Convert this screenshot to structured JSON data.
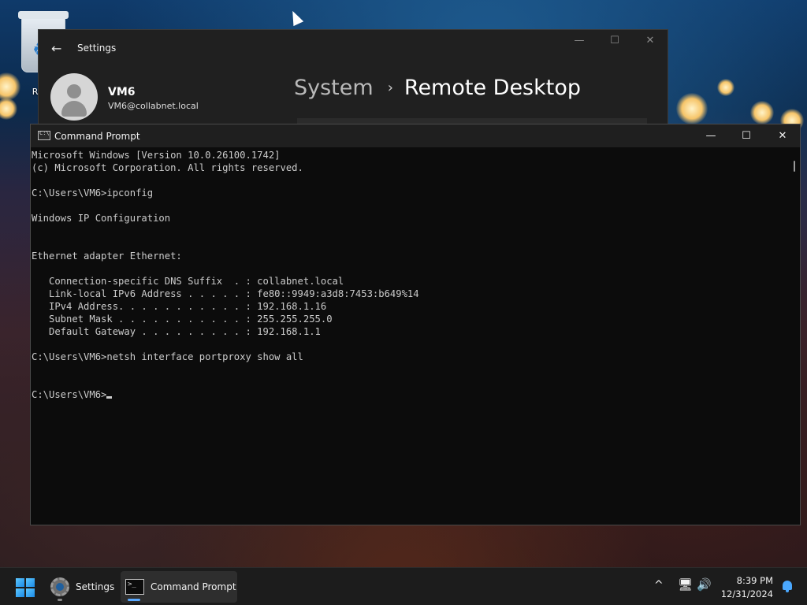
{
  "desktop": {
    "recycle_bin_label": "Recy"
  },
  "settings_window": {
    "title": "Settings",
    "back_icon": "back-arrow-icon",
    "user": {
      "name": "VM6",
      "email": "VM6@collabnet.local"
    },
    "breadcrumb": {
      "parent": "System",
      "separator": "›",
      "current": "Remote Desktop"
    },
    "controls": {
      "minimize": "—",
      "maximize": "☐",
      "close": "✕"
    }
  },
  "cmd_window": {
    "title": "Command Prompt",
    "icon_text": "C:\\",
    "controls": {
      "minimize": "—",
      "maximize": "☐",
      "close": "✕"
    },
    "lines": [
      "Microsoft Windows [Version 10.0.26100.1742]",
      "(c) Microsoft Corporation. All rights reserved.",
      "",
      "C:\\Users\\VM6>ipconfig",
      "",
      "Windows IP Configuration",
      "",
      "",
      "Ethernet adapter Ethernet:",
      "",
      "   Connection-specific DNS Suffix  . : collabnet.local",
      "   Link-local IPv6 Address . . . . . : fe80::9949:a3d8:7453:b649%14",
      "   IPv4 Address. . . . . . . . . . . : 192.168.1.16",
      "   Subnet Mask . . . . . . . . . . . : 255.255.255.0",
      "   Default Gateway . . . . . . . . . : 192.168.1.1",
      "",
      "C:\\Users\\VM6>netsh interface portproxy show all",
      "",
      "",
      "C:\\Users\\VM6>"
    ]
  },
  "taskbar": {
    "start_icon": "windows-start-icon",
    "items": [
      {
        "label": "Settings",
        "icon": "settings-gear-icon"
      },
      {
        "label": "Command Prompt",
        "icon": "command-prompt-icon"
      }
    ],
    "tray": {
      "chevron": "^",
      "network_icon": "network-icon",
      "volume_icon": "volume-icon",
      "time": "8:39 PM",
      "date": "12/31/2024",
      "notification_icon": "notification-bell-icon"
    }
  },
  "colors": {
    "console_bg": "#0c0c0c",
    "console_fg": "#cccccc",
    "titlebar": "#1f1f1f",
    "taskbar": "#1c1c1c",
    "accent": "#4aa8ff"
  }
}
